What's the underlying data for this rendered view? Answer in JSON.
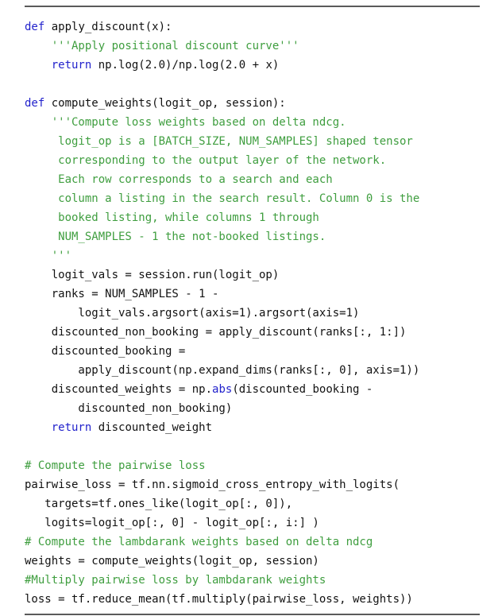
{
  "figure": {
    "kind": "code-listing",
    "language": "python",
    "background_color": "#ffffff",
    "rule_color": "#5a5a5a",
    "colors": {
      "plain": "#111111",
      "keyword": "#2222cc",
      "builtin": "#2222cc",
      "string": "#3f9e3f",
      "comment": "#3f9e3f"
    }
  },
  "code": {
    "lines": [
      {
        "tokens": [
          {
            "t": "kw",
            "s": "def"
          },
          {
            "t": "pl",
            "s": " apply_discount(x):"
          }
        ]
      },
      {
        "tokens": [
          {
            "t": "str",
            "s": "    '''Apply positional discount curve'''"
          }
        ]
      },
      {
        "tokens": [
          {
            "t": "pl",
            "s": "    "
          },
          {
            "t": "kw",
            "s": "return"
          },
          {
            "t": "pl",
            "s": " np.log(2.0)/np.log(2.0 + x)"
          }
        ]
      },
      {
        "tokens": [
          {
            "t": "pl",
            "s": ""
          }
        ]
      },
      {
        "tokens": [
          {
            "t": "kw",
            "s": "def"
          },
          {
            "t": "pl",
            "s": " compute_weights(logit_op, session):"
          }
        ]
      },
      {
        "tokens": [
          {
            "t": "str",
            "s": "    '''Compute loss weights based on delta ndcg."
          }
        ]
      },
      {
        "tokens": [
          {
            "t": "str",
            "s": "     logit_op is a [BATCH_SIZE, NUM_SAMPLES] shaped tensor"
          }
        ]
      },
      {
        "tokens": [
          {
            "t": "str",
            "s": "     corresponding to the output layer of the network."
          }
        ]
      },
      {
        "tokens": [
          {
            "t": "str",
            "s": "     Each row corresponds to a search and each"
          }
        ]
      },
      {
        "tokens": [
          {
            "t": "str",
            "s": "     column a listing in the search result. Column 0 is the"
          }
        ]
      },
      {
        "tokens": [
          {
            "t": "str",
            "s": "     booked listing, while columns 1 through"
          }
        ]
      },
      {
        "tokens": [
          {
            "t": "str",
            "s": "     NUM_SAMPLES - 1 the not-booked listings."
          }
        ]
      },
      {
        "tokens": [
          {
            "t": "str",
            "s": "    '''"
          }
        ]
      },
      {
        "tokens": [
          {
            "t": "pl",
            "s": "    logit_vals = session.run(logit_op)"
          }
        ]
      },
      {
        "tokens": [
          {
            "t": "pl",
            "s": "    ranks = NUM_SAMPLES - 1 -"
          }
        ]
      },
      {
        "tokens": [
          {
            "t": "pl",
            "s": "        logit_vals.argsort(axis=1).argsort(axis=1)"
          }
        ]
      },
      {
        "tokens": [
          {
            "t": "pl",
            "s": "    discounted_non_booking = apply_discount(ranks[:, 1:])"
          }
        ]
      },
      {
        "tokens": [
          {
            "t": "pl",
            "s": "    discounted_booking ="
          }
        ]
      },
      {
        "tokens": [
          {
            "t": "pl",
            "s": "        apply_discount(np.expand_dims(ranks[:, 0], axis=1))"
          }
        ]
      },
      {
        "tokens": [
          {
            "t": "pl",
            "s": "    discounted_weights = np."
          },
          {
            "t": "bi",
            "s": "abs"
          },
          {
            "t": "pl",
            "s": "(discounted_booking -"
          }
        ]
      },
      {
        "tokens": [
          {
            "t": "pl",
            "s": "        discounted_non_booking)"
          }
        ]
      },
      {
        "tokens": [
          {
            "t": "pl",
            "s": "    "
          },
          {
            "t": "kw",
            "s": "return"
          },
          {
            "t": "pl",
            "s": " discounted_weight"
          }
        ]
      },
      {
        "tokens": [
          {
            "t": "pl",
            "s": ""
          }
        ]
      },
      {
        "tokens": [
          {
            "t": "cmt",
            "s": "# Compute the pairwise loss"
          }
        ]
      },
      {
        "tokens": [
          {
            "t": "pl",
            "s": "pairwise_loss = tf.nn.sigmoid_cross_entropy_with_logits("
          }
        ]
      },
      {
        "tokens": [
          {
            "t": "pl",
            "s": "   targets=tf.ones_like(logit_op[:, 0]),"
          }
        ]
      },
      {
        "tokens": [
          {
            "t": "pl",
            "s": "   logits=logit_op[:, 0] - logit_op[:, i:] )"
          }
        ]
      },
      {
        "tokens": [
          {
            "t": "cmt",
            "s": "# Compute the lambdarank weights based on delta ndcg"
          }
        ]
      },
      {
        "tokens": [
          {
            "t": "pl",
            "s": "weights = compute_weights(logit_op, session)"
          }
        ]
      },
      {
        "tokens": [
          {
            "t": "cmt",
            "s": "#Multiply pairwise loss by lambdarank weights"
          }
        ]
      },
      {
        "tokens": [
          {
            "t": "pl",
            "s": "loss = tf.reduce_mean(tf.multiply(pairwise_loss, weights))"
          }
        ]
      }
    ]
  }
}
